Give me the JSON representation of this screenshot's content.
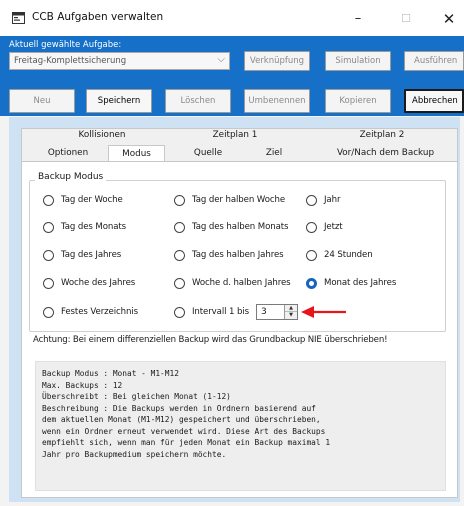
{
  "window": {
    "title": "CCB Aufgaben verwalten",
    "controls": {
      "minimize": "–",
      "maximize": "☐",
      "close": "✕"
    }
  },
  "task": {
    "label": "Aktuell gewählte Aufgabe:",
    "selected": "Freitag-Komplettsicherung"
  },
  "buttons": {
    "verknuepfung": "Verknüpfung",
    "simulation": "Simulation",
    "ausfuehren": "Ausführen",
    "neu": "Neu",
    "speichern": "Speichern",
    "loeschen": "Löschen",
    "umbenennen": "Umbenennen",
    "kopieren": "Kopieren",
    "abbrechen": "Abbrechen"
  },
  "tabs": {
    "row1": [
      "Kollisionen",
      "Zeitplan 1",
      "Zeitplan 2"
    ],
    "row2": [
      "Optionen",
      "Modus",
      "Quelle",
      "Ziel",
      "Vor/Nach dem Backup"
    ],
    "selected": "Modus"
  },
  "backup_mode": {
    "title": "Backup Modus",
    "options": [
      "Tag der Woche",
      "Tag der halben Woche",
      "Jahr",
      "Tag des Monats",
      "Tag des halben Monats",
      "Jetzt",
      "Tag des Jahres",
      "Tag des halben Jahres",
      "24 Stunden",
      "Woche des Jahres",
      "Woche d. halben Jahres",
      "Monat des Jahres",
      "Festes Verzeichnis",
      "Intervall 1 bis"
    ],
    "selected": "Monat des Jahres",
    "interval_value": "3"
  },
  "warning": "Achtung: Bei einem differenziellen Backup wird das Grundbackup NIE überschrieben!",
  "info_lines": [
    "Backup Modus : Monat - M1-M12",
    "Max. Backups : 12",
    "Überschreibt : Bei gleichen Monat (1-12)",
    "Beschreibung : Die Backups werden in Ordnern basierend auf",
    "dem aktuellen Monat (M1-M12) gespeichert und überschrieben,",
    "wenn ein Ordner erneut verwendet wird. Diese Art des Backups",
    "empfiehlt sich, wenn man für jeden Monat ein Backup maximal 1",
    "Jahr pro Backupmedium speichern möchte."
  ],
  "colors": {
    "accent": "#1670c8",
    "panel": "#cfe2f4",
    "arrow": "#e8141b"
  }
}
